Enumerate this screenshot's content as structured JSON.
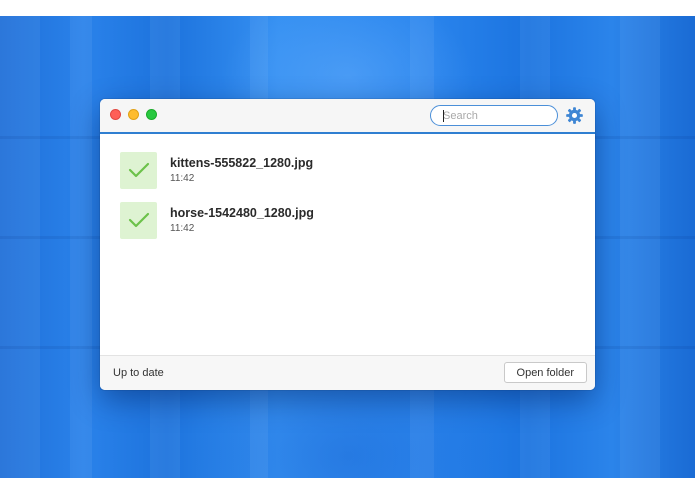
{
  "window": {
    "search": {
      "placeholder": "Search",
      "value": ""
    },
    "settings_icon": "gear-icon"
  },
  "files": [
    {
      "name": "kittens-555822_1280.jpg",
      "time": "11:42",
      "status_icon": "check-icon"
    },
    {
      "name": "horse-1542480_1280.jpg",
      "time": "11:42",
      "status_icon": "check-icon"
    }
  ],
  "footer": {
    "status": "Up to date",
    "open_folder_label": "Open folder"
  },
  "colors": {
    "accent": "#2f7fd1",
    "check_bg": "#def3d2",
    "check_mark": "#6cc24a",
    "background_blue": "#2a82ea"
  }
}
